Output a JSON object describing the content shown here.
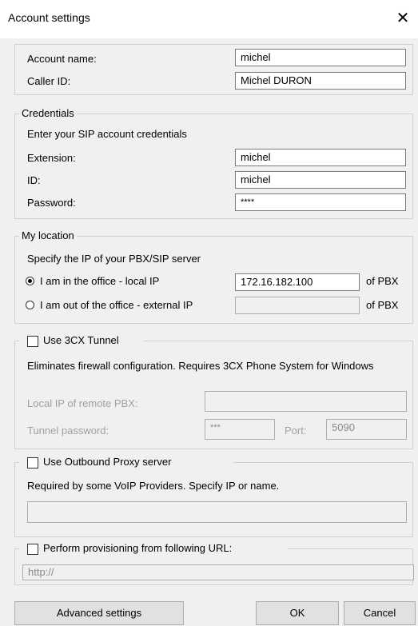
{
  "window": {
    "title": "Account settings",
    "close_glyph": "✕"
  },
  "account": {
    "name_label": "Account name:",
    "name_value": "michel",
    "caller_label": "Caller ID:",
    "caller_value": "Michel DURON"
  },
  "credentials": {
    "legend": "Credentials",
    "hint": "Enter your SIP account credentials",
    "extension_label": "Extension:",
    "extension_value": "michel",
    "id_label": "ID:",
    "id_value": "michel",
    "password_label": "Password:",
    "password_value": "****"
  },
  "location": {
    "legend": "My location",
    "hint": "Specify the IP of your PBX/SIP server",
    "local_label": "I am in the office - local IP",
    "local_value": "172.16.182.100",
    "local_suffix": "of PBX",
    "external_label": "I am out of the office - external IP",
    "external_value": "",
    "external_suffix": "of PBX",
    "selected": "local"
  },
  "tunnel": {
    "checkbox_label": "Use 3CX Tunnel",
    "checked": false,
    "description": "Eliminates firewall configuration. Requires 3CX Phone System for Windows",
    "remote_ip_label": "Local IP of remote PBX:",
    "remote_ip_value": "",
    "password_label": "Tunnel password:",
    "password_value": "***",
    "port_label": "Port:",
    "port_value": "5090"
  },
  "proxy": {
    "checkbox_label": "Use Outbound Proxy server",
    "checked": false,
    "description": "Required by some VoIP Providers. Specify IP or name.",
    "value": ""
  },
  "provisioning": {
    "checkbox_label": "Perform provisioning from following URL:",
    "checked": false,
    "url_placeholder": "http://"
  },
  "buttons": {
    "advanced": "Advanced settings",
    "ok": "OK",
    "cancel": "Cancel"
  }
}
